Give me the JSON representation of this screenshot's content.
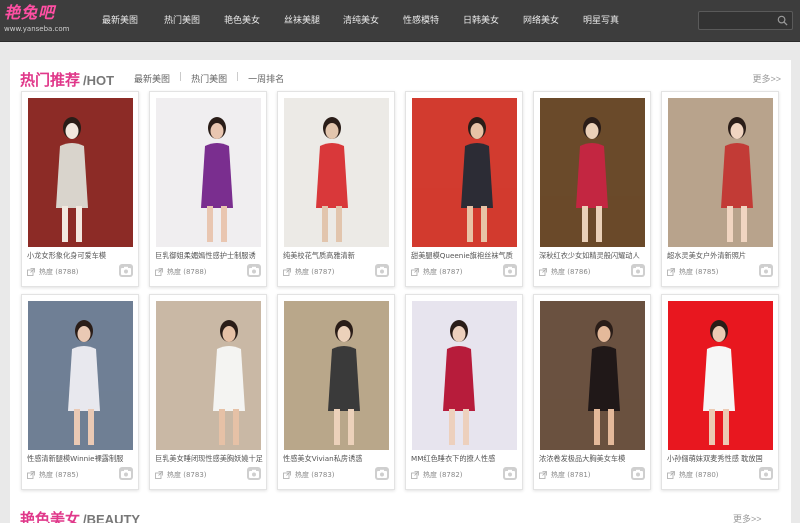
{
  "header": {
    "logo_text": "艳兔吧",
    "logo_url": "www.yanseba.com",
    "nav": [
      "最新美图",
      "热门美图",
      "艳色美女",
      "丝袜美腿",
      "清纯美女",
      "性感模特",
      "日韩美女",
      "网络美女",
      "明星写真"
    ],
    "search_placeholder": ""
  },
  "hot": {
    "title_zh": "热门推荐",
    "title_en": "/HOT",
    "tabs": [
      "最新美图",
      "热门美图",
      "一周排名"
    ],
    "more": "更多>>",
    "items": [
      {
        "title": "小龙女形象化身可爱车模",
        "heat": "热度 (8788)"
      },
      {
        "title": "巨乳御姐柔媚嫣性感护士制服诱",
        "heat": "热度 (8788)"
      },
      {
        "title": "纯美校花气质高雅清新",
        "heat": "热度 (8787)"
      },
      {
        "title": "甜美腿模Queenie旗袍丝袜气质",
        "heat": "热度 (8787)"
      },
      {
        "title": "深秋红衣少女如精灵般闪耀动人",
        "heat": "热度 (8786)"
      },
      {
        "title": "超水灵美女户外清新照片",
        "heat": "热度 (8785)"
      },
      {
        "title": "性感清新腿模Winnie裸露制服",
        "heat": "热度 (8785)"
      },
      {
        "title": "巨乳美女睡闭现性感美胸妖嬈十足",
        "heat": "热度 (8783)"
      },
      {
        "title": "性感美女Vivian私房诱惑",
        "heat": "热度 (8783)"
      },
      {
        "title": "MM红色睡衣下的撩人性感",
        "heat": "热度 (8782)"
      },
      {
        "title": "浓浓卷发极品大胸美女车模",
        "heat": "热度 (8781)"
      },
      {
        "title": "小孙俪萌妹双麦秀性感 耽放国",
        "heat": "热度 (8780)"
      }
    ]
  },
  "beauty": {
    "title_zh": "艳色美女",
    "title_en": "/BEAUTY",
    "more": "更多>>"
  },
  "colors": {
    "header_bg": "#3d3d3d",
    "accent": "#e0388a",
    "page_bg": "#e9e9e9"
  },
  "photo_palettes": [
    [
      "#8c2b26",
      "#d9d4cc",
      "#f2e8df"
    ],
    [
      "#f0eef0",
      "#7a2e8f",
      "#e9c6b1"
    ],
    [
      "#eceae6",
      "#d9383a",
      "#e2c5ad"
    ],
    [
      "#d23b2f",
      "#2c2c35",
      "#e8c3a6"
    ],
    [
      "#6a4a2a",
      "#c32641",
      "#ead0b8"
    ],
    [
      "#b8a38c",
      "#c23b36",
      "#f1d5c1"
    ],
    [
      "#6f7f95",
      "#e8e8ee",
      "#eac9b4"
    ],
    [
      "#c9b8a5",
      "#f4f4f2",
      "#e6c1a6"
    ],
    [
      "#b9a78a",
      "#3a3a3a",
      "#ecd1ba"
    ],
    [
      "#e7e4ee",
      "#b71c3b",
      "#edd0bd"
    ],
    [
      "#6a5140",
      "#201818",
      "#e4b99a"
    ],
    [
      "#e8171f",
      "#f6f6f6",
      "#eccab4"
    ]
  ]
}
